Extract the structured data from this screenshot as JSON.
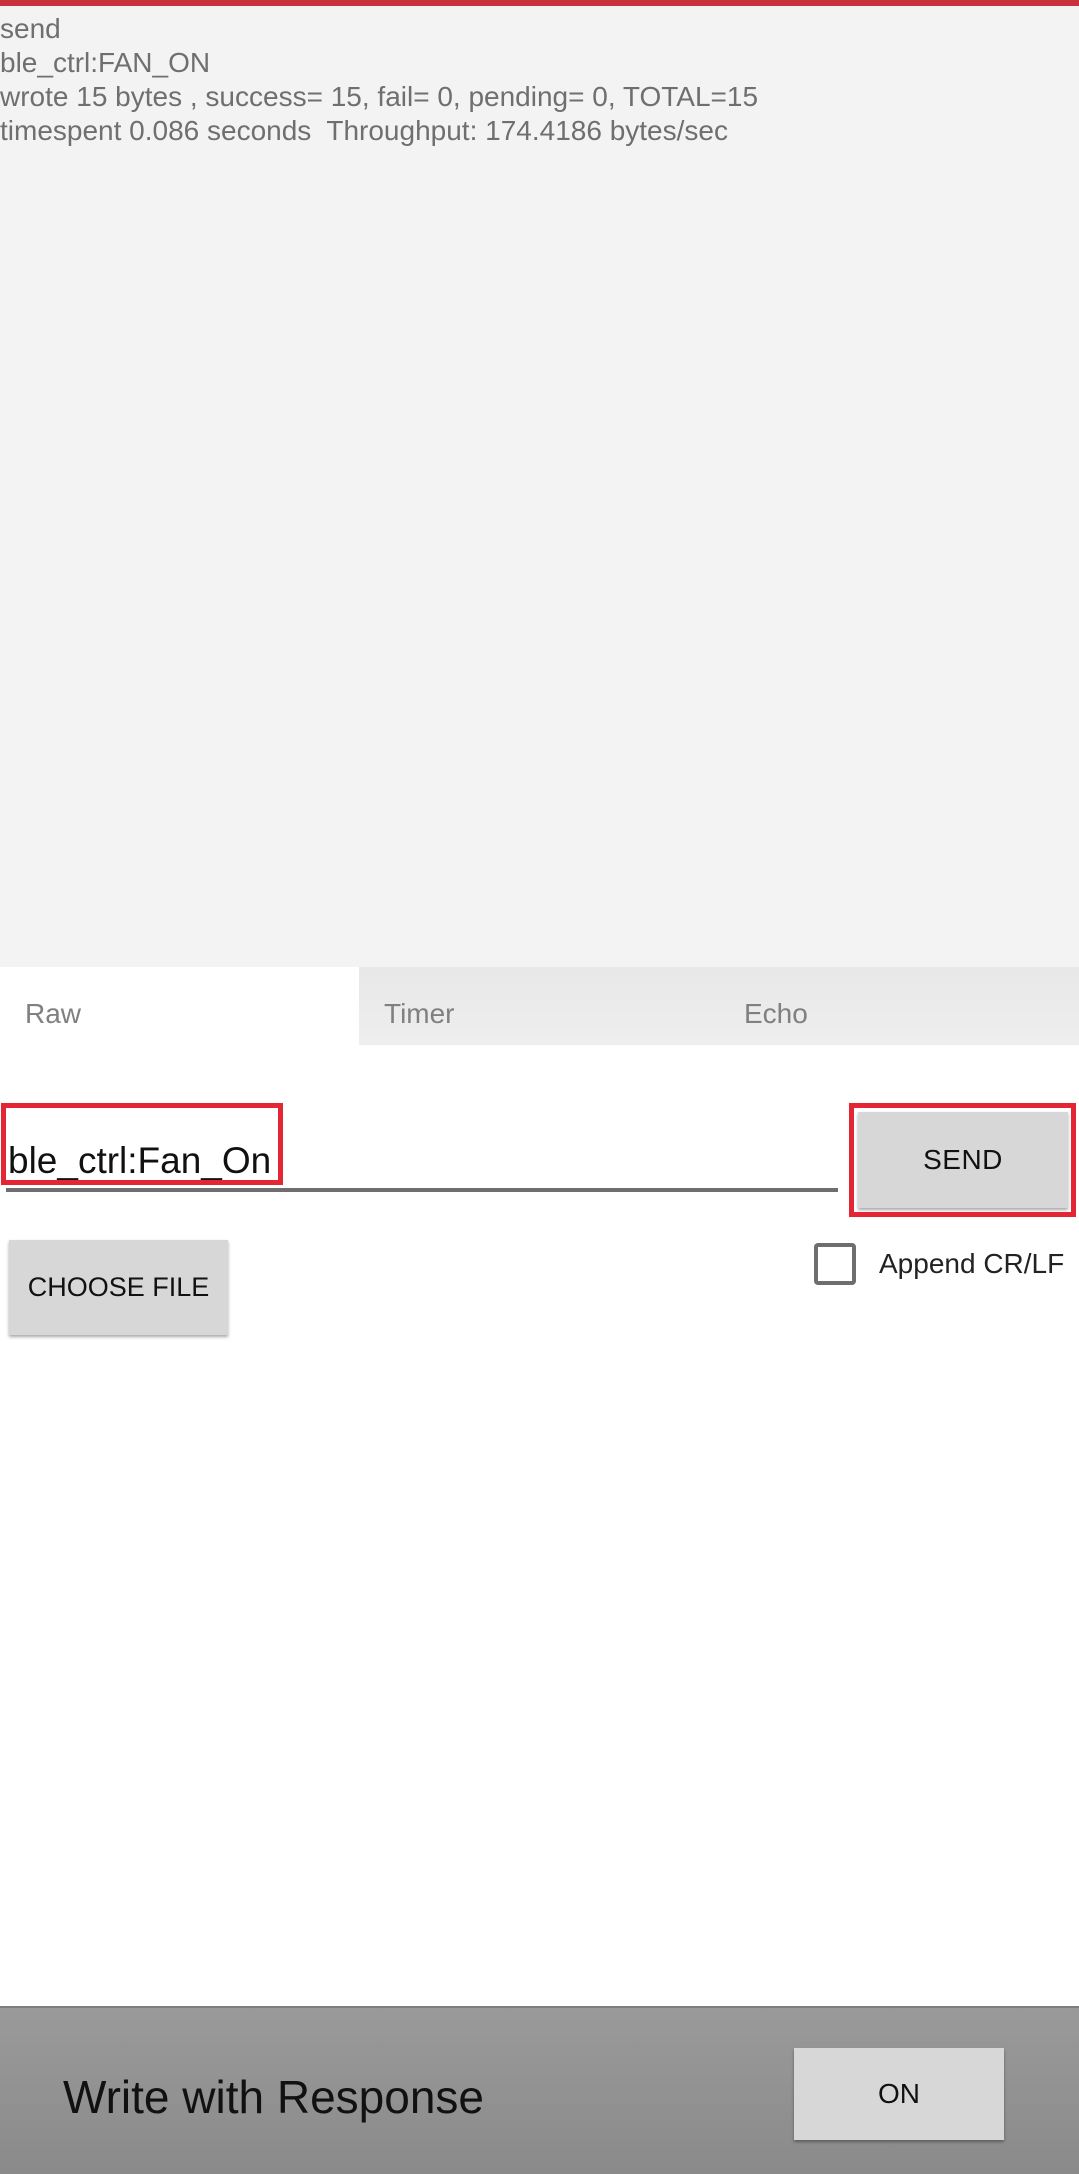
{
  "log": {
    "lines": [
      "send",
      "ble_ctrl:FAN_ON",
      "wrote 15 bytes , success= 15, fail= 0, pending= 0, TOTAL=15",
      "timespent 0.086 seconds  Throughput: 174.4186 bytes/sec"
    ]
  },
  "tabs": [
    {
      "label": "Raw",
      "active": true
    },
    {
      "label": "Timer",
      "active": false
    },
    {
      "label": "Echo",
      "active": false
    }
  ],
  "input": {
    "value": "ble_ctrl:Fan_On"
  },
  "buttons": {
    "send": "SEND",
    "choose_file": "CHOOSE FILE",
    "on": "ON"
  },
  "append": {
    "label": "Append CR/LF",
    "checked": false
  },
  "bottom": {
    "label": "Write with Response"
  },
  "colors": {
    "accent_top": "#c9313d",
    "highlight": "#e32633"
  }
}
